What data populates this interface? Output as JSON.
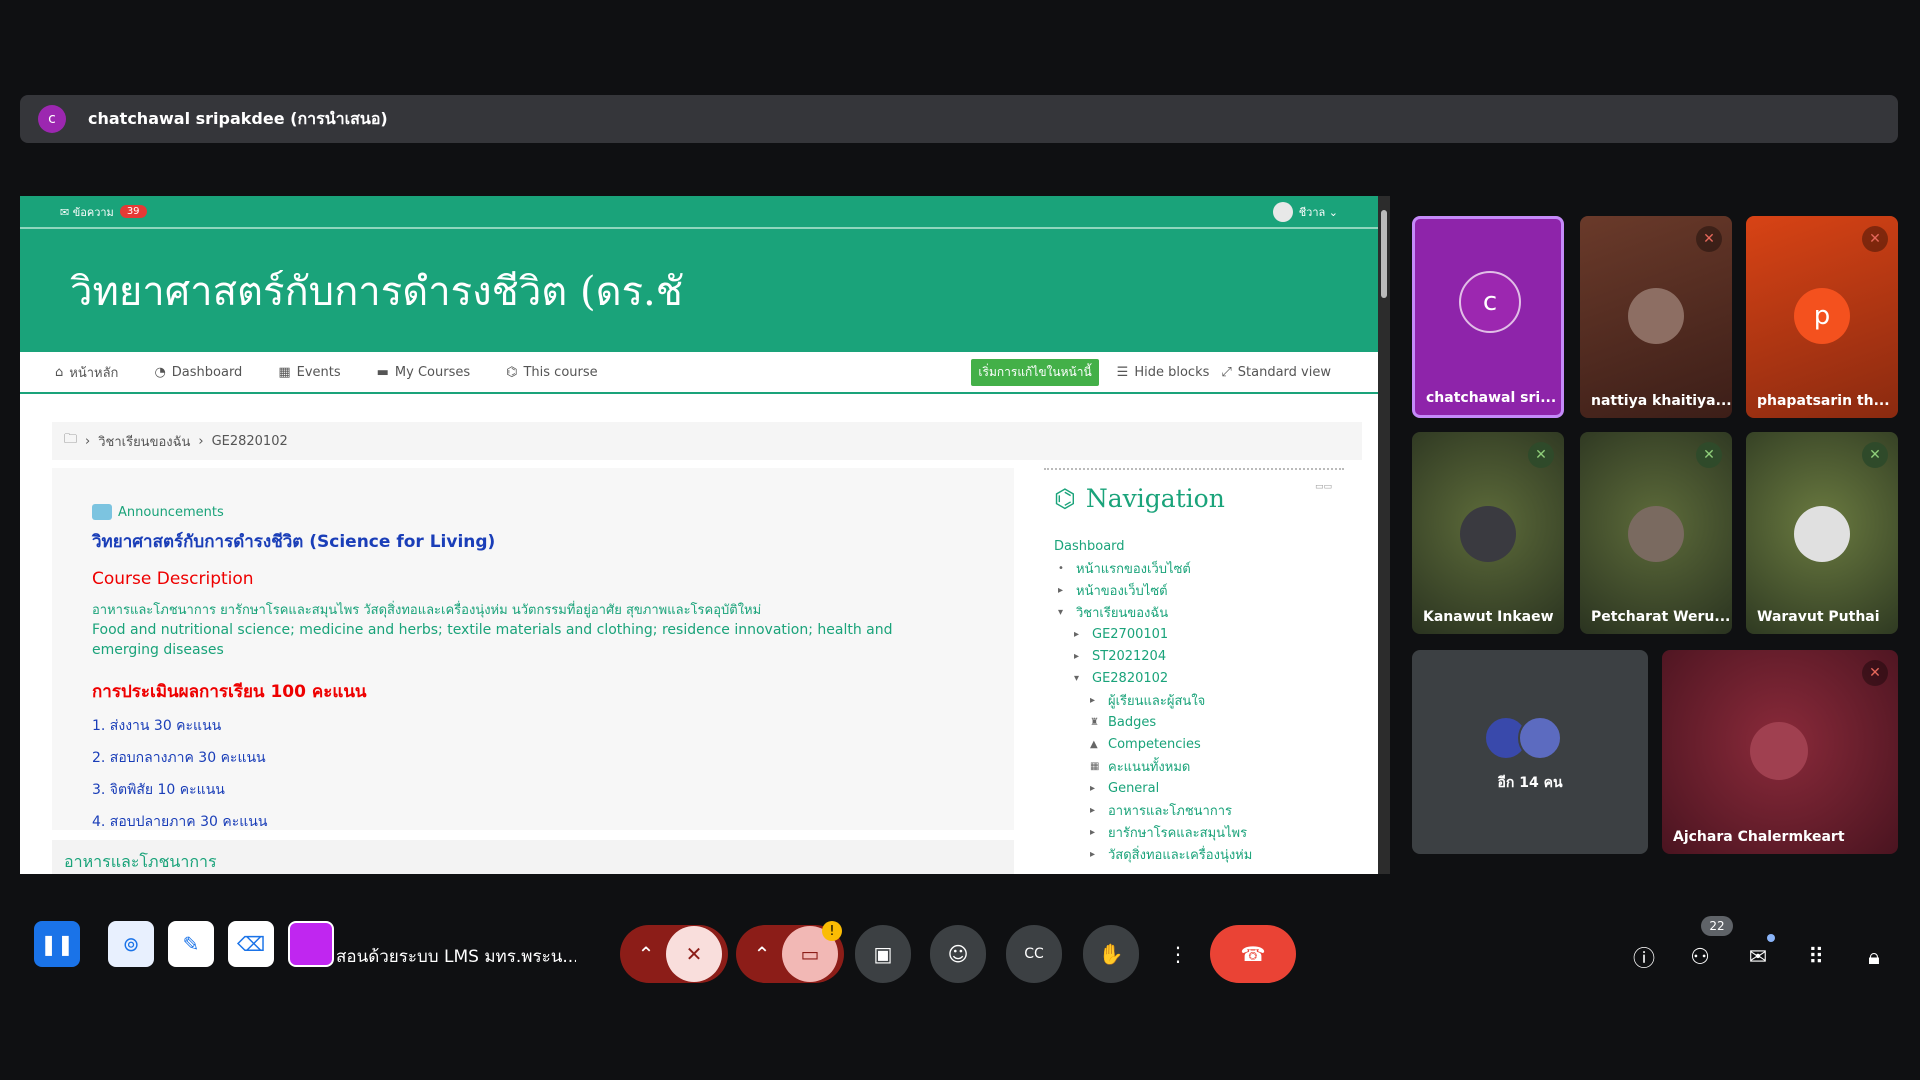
{
  "presenter": {
    "avatar_letter": "c",
    "name": "chatchawal sripakdee (การนำเสนอ)"
  },
  "lms": {
    "topbar": {
      "messages_label": "✉ ข้อความ",
      "message_count": "39",
      "user_label": "ชีวาล ⌄"
    },
    "course_title": "วิทยาศาสตร์กับการดำรงชีวิต (ดร.ชั",
    "nav": {
      "home": "หน้าหลัก",
      "dashboard": "Dashboard",
      "events": "Events",
      "my_courses": "My Courses",
      "this_course": "This course",
      "edit_button": "เริ่มการแก้ไขในหน้านี้",
      "hide_blocks": "Hide blocks",
      "standard_view": "Standard view"
    },
    "breadcrumb": {
      "item1": "วิชาเรียนของฉัน",
      "item2": "GE2820102"
    },
    "main": {
      "announcements": "Announcements",
      "heading": "วิทยาศาสตร์กับการดำรงชีวิต (Science for Living)",
      "desc_title": "Course Description",
      "desc_thai": "อาหารและโภชนาการ ยารักษาโรคและสมุนไพร วัสดุสิ่งทอและเครื่องนุ่งห่ม นวัตกรรมที่อยู่อาศัย สุขภาพและโรคอุบัติใหม่",
      "desc_en": "Food and nutritional science; medicine and herbs; textile materials and clothing; residence innovation; health and emerging diseases",
      "eval_title": "การประเมินผลการเรียน 100 คะแนน",
      "eval_items": [
        "1. ส่งงาน 30 คะแนน",
        "2. สอบกลางภาค 30 คะแนน",
        "3. จิตพิสัย 10 คะแนน",
        "4. สอบปลายภาค 30 คะแนน"
      ],
      "next_section": "อาหารและโภชนาการ"
    },
    "navigation": {
      "title": "Navigation",
      "dashboard": "Dashboard",
      "tree": [
        "หน้าแรกของเว็บไซต์",
        "หน้าของเว็บไซต์",
        "วิชาเรียนของฉัน",
        "GE2700101",
        "ST2021204",
        "GE2820102",
        "ผู้เรียนและผู้สนใจ",
        "Badges",
        "Competencies",
        "คะแนนทั้งหมด",
        "General",
        "อาหารและโภชนาการ",
        "ยารักษาโรคและสมุนไพร",
        "วัสดุสิ่งทอและเครื่องนุ่งห่ม"
      ]
    }
  },
  "participants": [
    {
      "name": "chatchawal sri...",
      "letter": "c",
      "color": "#8e24aa",
      "muted": false
    },
    {
      "name": "nattiya khaitiya...",
      "letter": "",
      "color": "#5a2a22",
      "muted": true
    },
    {
      "name": "phapatsarin th...",
      "letter": "p",
      "color": "#d84315",
      "muted": true
    },
    {
      "name": "Kanawut Inkaew",
      "letter": "",
      "color": "#3d4a2c",
      "muted": true
    },
    {
      "name": "Petcharat Weru...",
      "letter": "",
      "color": "#3c4a30",
      "muted": true
    },
    {
      "name": "Waravut Puthai",
      "letter": "",
      "color": "#4a5a30",
      "muted": true
    },
    {
      "name": "อีก 14 คน",
      "letter": "",
      "color": "#3c4043",
      "muted": false
    },
    {
      "name": "Ajchara Chalermkeart",
      "letter": "",
      "color": "#6a1c2a",
      "muted": true
    }
  ],
  "toolbar": {
    "meeting_title": "สอนด้วยระบบ LMS มทร.พระน...",
    "participant_count": "22",
    "icons": [
      "pause-icon",
      "lasso-icon",
      "pen-icon",
      "eraser-icon",
      "color-swatch",
      "chevron-up-icon",
      "mic-off-icon",
      "camera-off-icon",
      "present-icon",
      "emoji-icon",
      "captions-icon",
      "raise-hand-icon",
      "more-icon",
      "hang-up-icon",
      "info-icon",
      "people-icon",
      "chat-icon",
      "activities-icon",
      "lock-icon"
    ]
  }
}
